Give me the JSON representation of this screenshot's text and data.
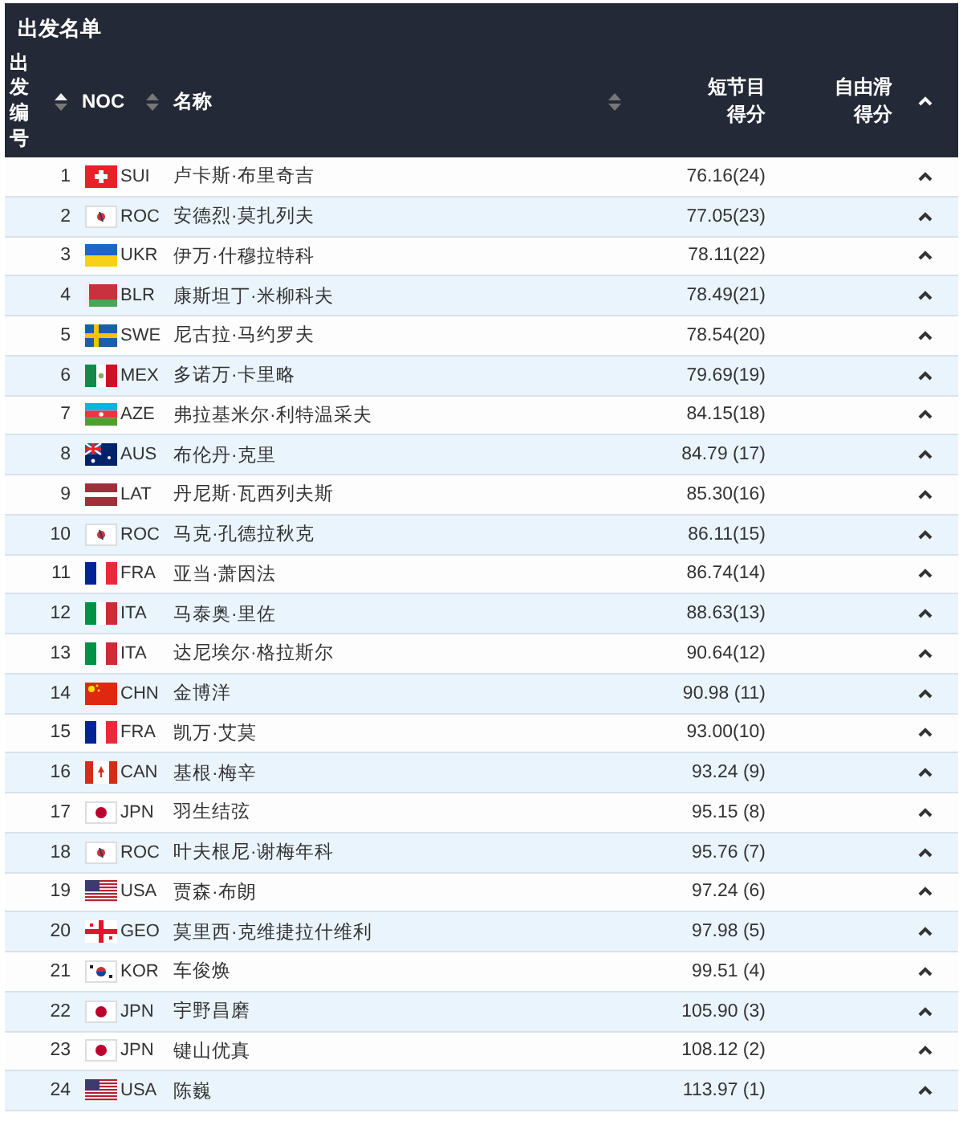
{
  "title": "出发名单",
  "columns": [
    {
      "kind": "vertical",
      "label": "出发编号",
      "sorted": true
    },
    {
      "kind": "plain",
      "label": "NOC",
      "sorted": false
    },
    {
      "kind": "plain",
      "label": "名称",
      "sorted": false
    },
    {
      "kind": "score",
      "label": "短节目得分"
    },
    {
      "kind": "score",
      "label": "自由滑得分"
    }
  ],
  "rows": [
    {
      "no": "1",
      "kind": "sui",
      "noc": "SUI",
      "name": "卢卡斯·布里奇吉",
      "short": "76.16(24)"
    },
    {
      "no": "2",
      "kind": "roc",
      "noc": "ROC",
      "name": "安德烈·莫扎列夫",
      "short": "77.05(23)"
    },
    {
      "no": "3",
      "kind": "ukr",
      "noc": "UKR",
      "name": "伊万·什穆拉特科",
      "short": "78.11(22)"
    },
    {
      "no": "4",
      "kind": "blr",
      "noc": "BLR",
      "name": "康斯坦丁·米柳科夫",
      "short": "78.49(21)"
    },
    {
      "no": "5",
      "kind": "swe",
      "noc": "SWE",
      "name": "尼古拉·马约罗夫",
      "short": "78.54(20)"
    },
    {
      "no": "6",
      "kind": "mex",
      "noc": "MEX",
      "name": "多诺万·卡里略",
      "short": "79.69(19)"
    },
    {
      "no": "7",
      "kind": "aze",
      "noc": "AZE",
      "name": "弗拉基米尔·利特温采夫",
      "short": "84.15(18)"
    },
    {
      "no": "8",
      "kind": "aus",
      "noc": "AUS",
      "name": "布伦丹·克里",
      "short": "84.79 (17)"
    },
    {
      "no": "9",
      "kind": "lat",
      "noc": "LAT",
      "name": "丹尼斯·瓦西列夫斯",
      "short": "85.30(16)"
    },
    {
      "no": "10",
      "kind": "roc",
      "noc": "ROC",
      "name": "马克·孔德拉秋克",
      "short": "86.11(15)"
    },
    {
      "no": "11",
      "kind": "fra",
      "noc": "FRA",
      "name": "亚当·萧因法",
      "short": "86.74(14)"
    },
    {
      "no": "12",
      "kind": "ita",
      "noc": "ITA",
      "name": "马泰奥·里佐",
      "short": "88.63(13)"
    },
    {
      "no": "13",
      "kind": "ita",
      "noc": "ITA",
      "name": "达尼埃尔·格拉斯尔",
      "short": "90.64(12)"
    },
    {
      "no": "14",
      "kind": "chn",
      "noc": "CHN",
      "name": "金博洋",
      "short": "90.98 (11)"
    },
    {
      "no": "15",
      "kind": "fra",
      "noc": "FRA",
      "name": "凯万·艾莫",
      "short": "93.00(10)"
    },
    {
      "no": "16",
      "kind": "can",
      "noc": "CAN",
      "name": "基根·梅辛",
      "short": "93.24 (9)"
    },
    {
      "no": "17",
      "kind": "jpn",
      "noc": "JPN",
      "name": "羽生结弦",
      "short": "95.15 (8)"
    },
    {
      "no": "18",
      "kind": "roc",
      "noc": "ROC",
      "name": "叶夫根尼·谢梅年科",
      "short": "95.76 (7)"
    },
    {
      "no": "19",
      "kind": "usa",
      "noc": "USA",
      "name": "贾森·布朗",
      "short": "97.24 (6)"
    },
    {
      "no": "20",
      "kind": "geo",
      "noc": "GEO",
      "name": "莫里西·克维捷拉什维利",
      "short": "97.98 (5)"
    },
    {
      "no": "21",
      "kind": "kor",
      "noc": "KOR",
      "name": "车俊焕",
      "short": "99.51 (4)"
    },
    {
      "no": "22",
      "kind": "jpn",
      "noc": "JPN",
      "name": "宇野昌磨",
      "short": "105.90 (3)"
    },
    {
      "no": "23",
      "kind": "jpn",
      "noc": "JPN",
      "name": "键山优真",
      "short": "108.12 (2)"
    },
    {
      "no": "24",
      "kind": "usa",
      "noc": "USA",
      "name": "陈巍",
      "short": "113.97 (1)"
    }
  ]
}
